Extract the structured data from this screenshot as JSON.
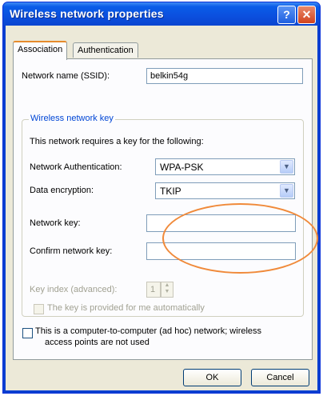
{
  "window": {
    "title": "Wireless network properties",
    "help_glyph": "?",
    "close_glyph": "✕"
  },
  "tabs": [
    {
      "label": "Association",
      "active": true
    },
    {
      "label": "Authentication",
      "active": false
    }
  ],
  "ssid": {
    "label": "Network name (SSID):",
    "value": "belkin54g"
  },
  "key_group": {
    "title": "Wireless network key",
    "description": "This network requires a key for the following:",
    "auth": {
      "label": "Network Authentication:",
      "value": "WPA-PSK"
    },
    "encryption": {
      "label": "Data encryption:",
      "value": "TKIP"
    },
    "network_key": {
      "label": "Network key:",
      "value": ""
    },
    "confirm_key": {
      "label": "Confirm network key:",
      "value": ""
    },
    "key_index": {
      "label": "Key index (advanced):",
      "value": "1"
    },
    "auto_key": {
      "label": "The key is provided for me automatically",
      "checked": false
    }
  },
  "adhoc": {
    "line1": "This is a computer-to-computer (ad hoc) network; wireless",
    "line2": "access points are not used",
    "checked": false
  },
  "buttons": {
    "ok": "OK",
    "cancel": "Cancel"
  },
  "colors": {
    "title_bar": "#0b4fde",
    "highlight_ellipse": "#f08a3a",
    "group_title": "#0046d5"
  }
}
